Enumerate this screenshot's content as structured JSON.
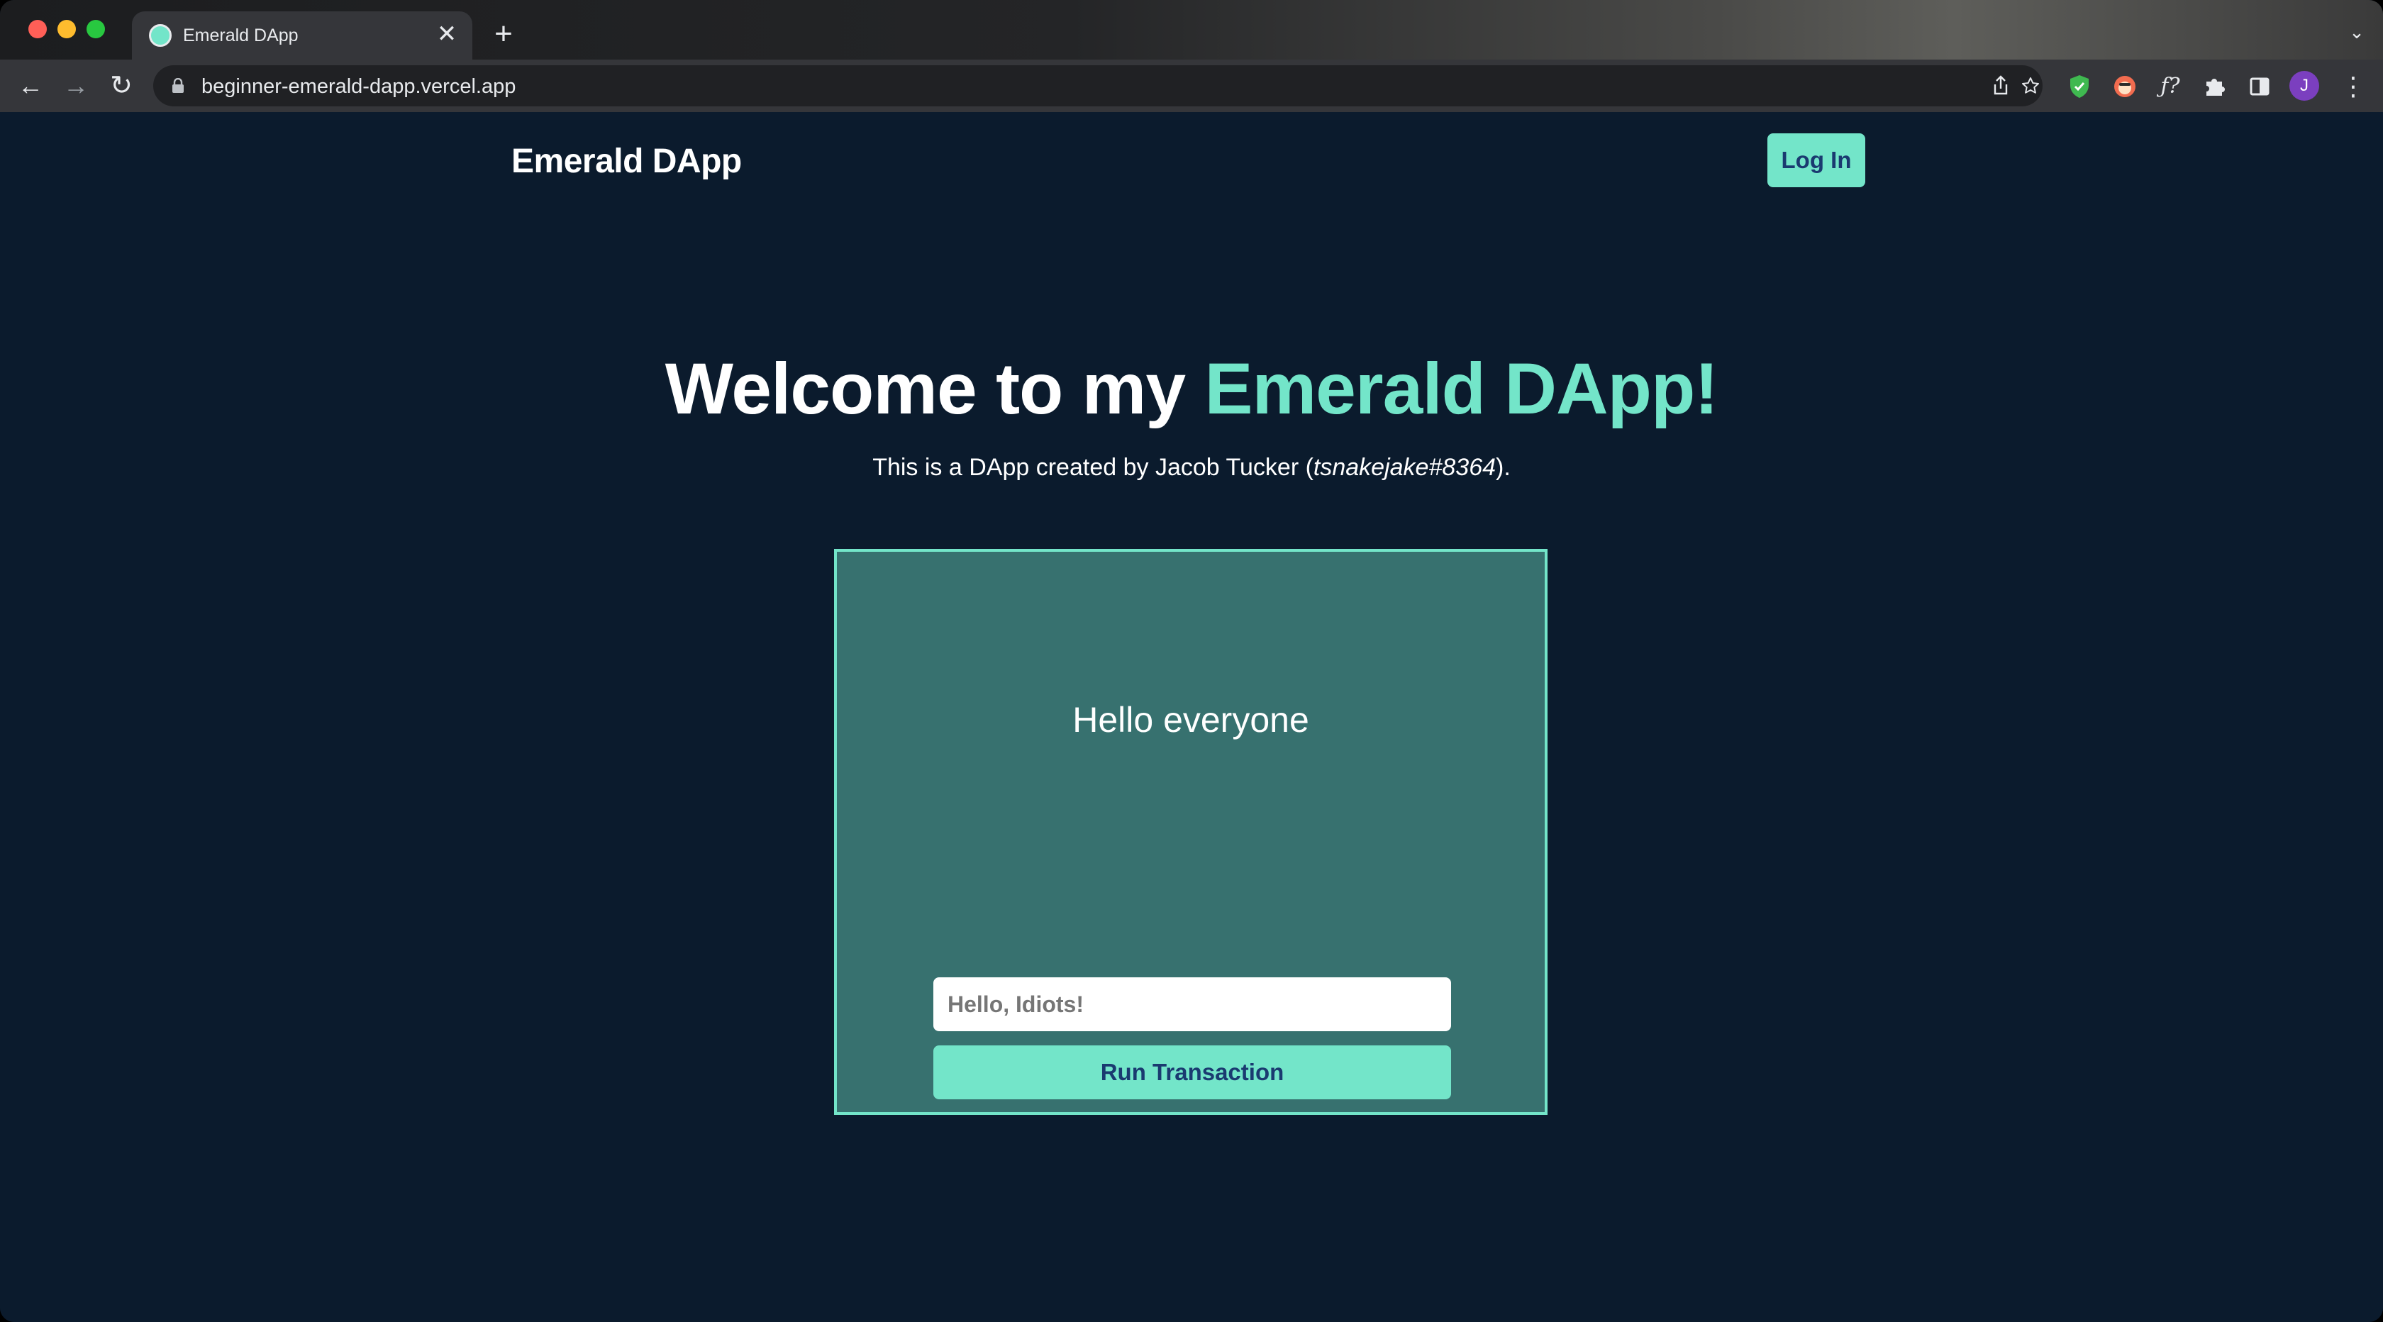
{
  "browser": {
    "tab": {
      "title": "Emerald DApp",
      "close_glyph": "✕"
    },
    "new_tab_glyph": "+",
    "tab_search_glyph": "⌄",
    "nav": {
      "back_glyph": "←",
      "forward_glyph": "→",
      "reload_glyph": "↻"
    },
    "url": "beginner-emerald-dapp.vercel.app",
    "omnibox_icons": [
      "share-icon",
      "bookmark-star-icon"
    ],
    "extensions": [
      "shield-extension-icon",
      "honey-extension-icon",
      "formula-extension-icon",
      "puzzle-extensions-icon",
      "side-panel-icon"
    ],
    "profile_initial": "J",
    "menu_glyph": "⋮"
  },
  "header": {
    "brand": "Emerald DApp",
    "login_label": "Log In"
  },
  "hero": {
    "title_plain": "Welcome to my ",
    "title_accent": "Emerald DApp!",
    "subtitle_prefix": "This is a DApp created by Jacob Tucker (",
    "subtitle_handle": "tsnakejake#8364",
    "subtitle_suffix": ")."
  },
  "card": {
    "greeting": "Hello everyone",
    "input_placeholder": "Hello, Idiots!",
    "run_label": "Run Transaction"
  },
  "colors": {
    "page_bg": "#0b1b2d",
    "accent": "#73e5c9",
    "card_bg": "#37716f",
    "button_text": "#1a3a70"
  }
}
